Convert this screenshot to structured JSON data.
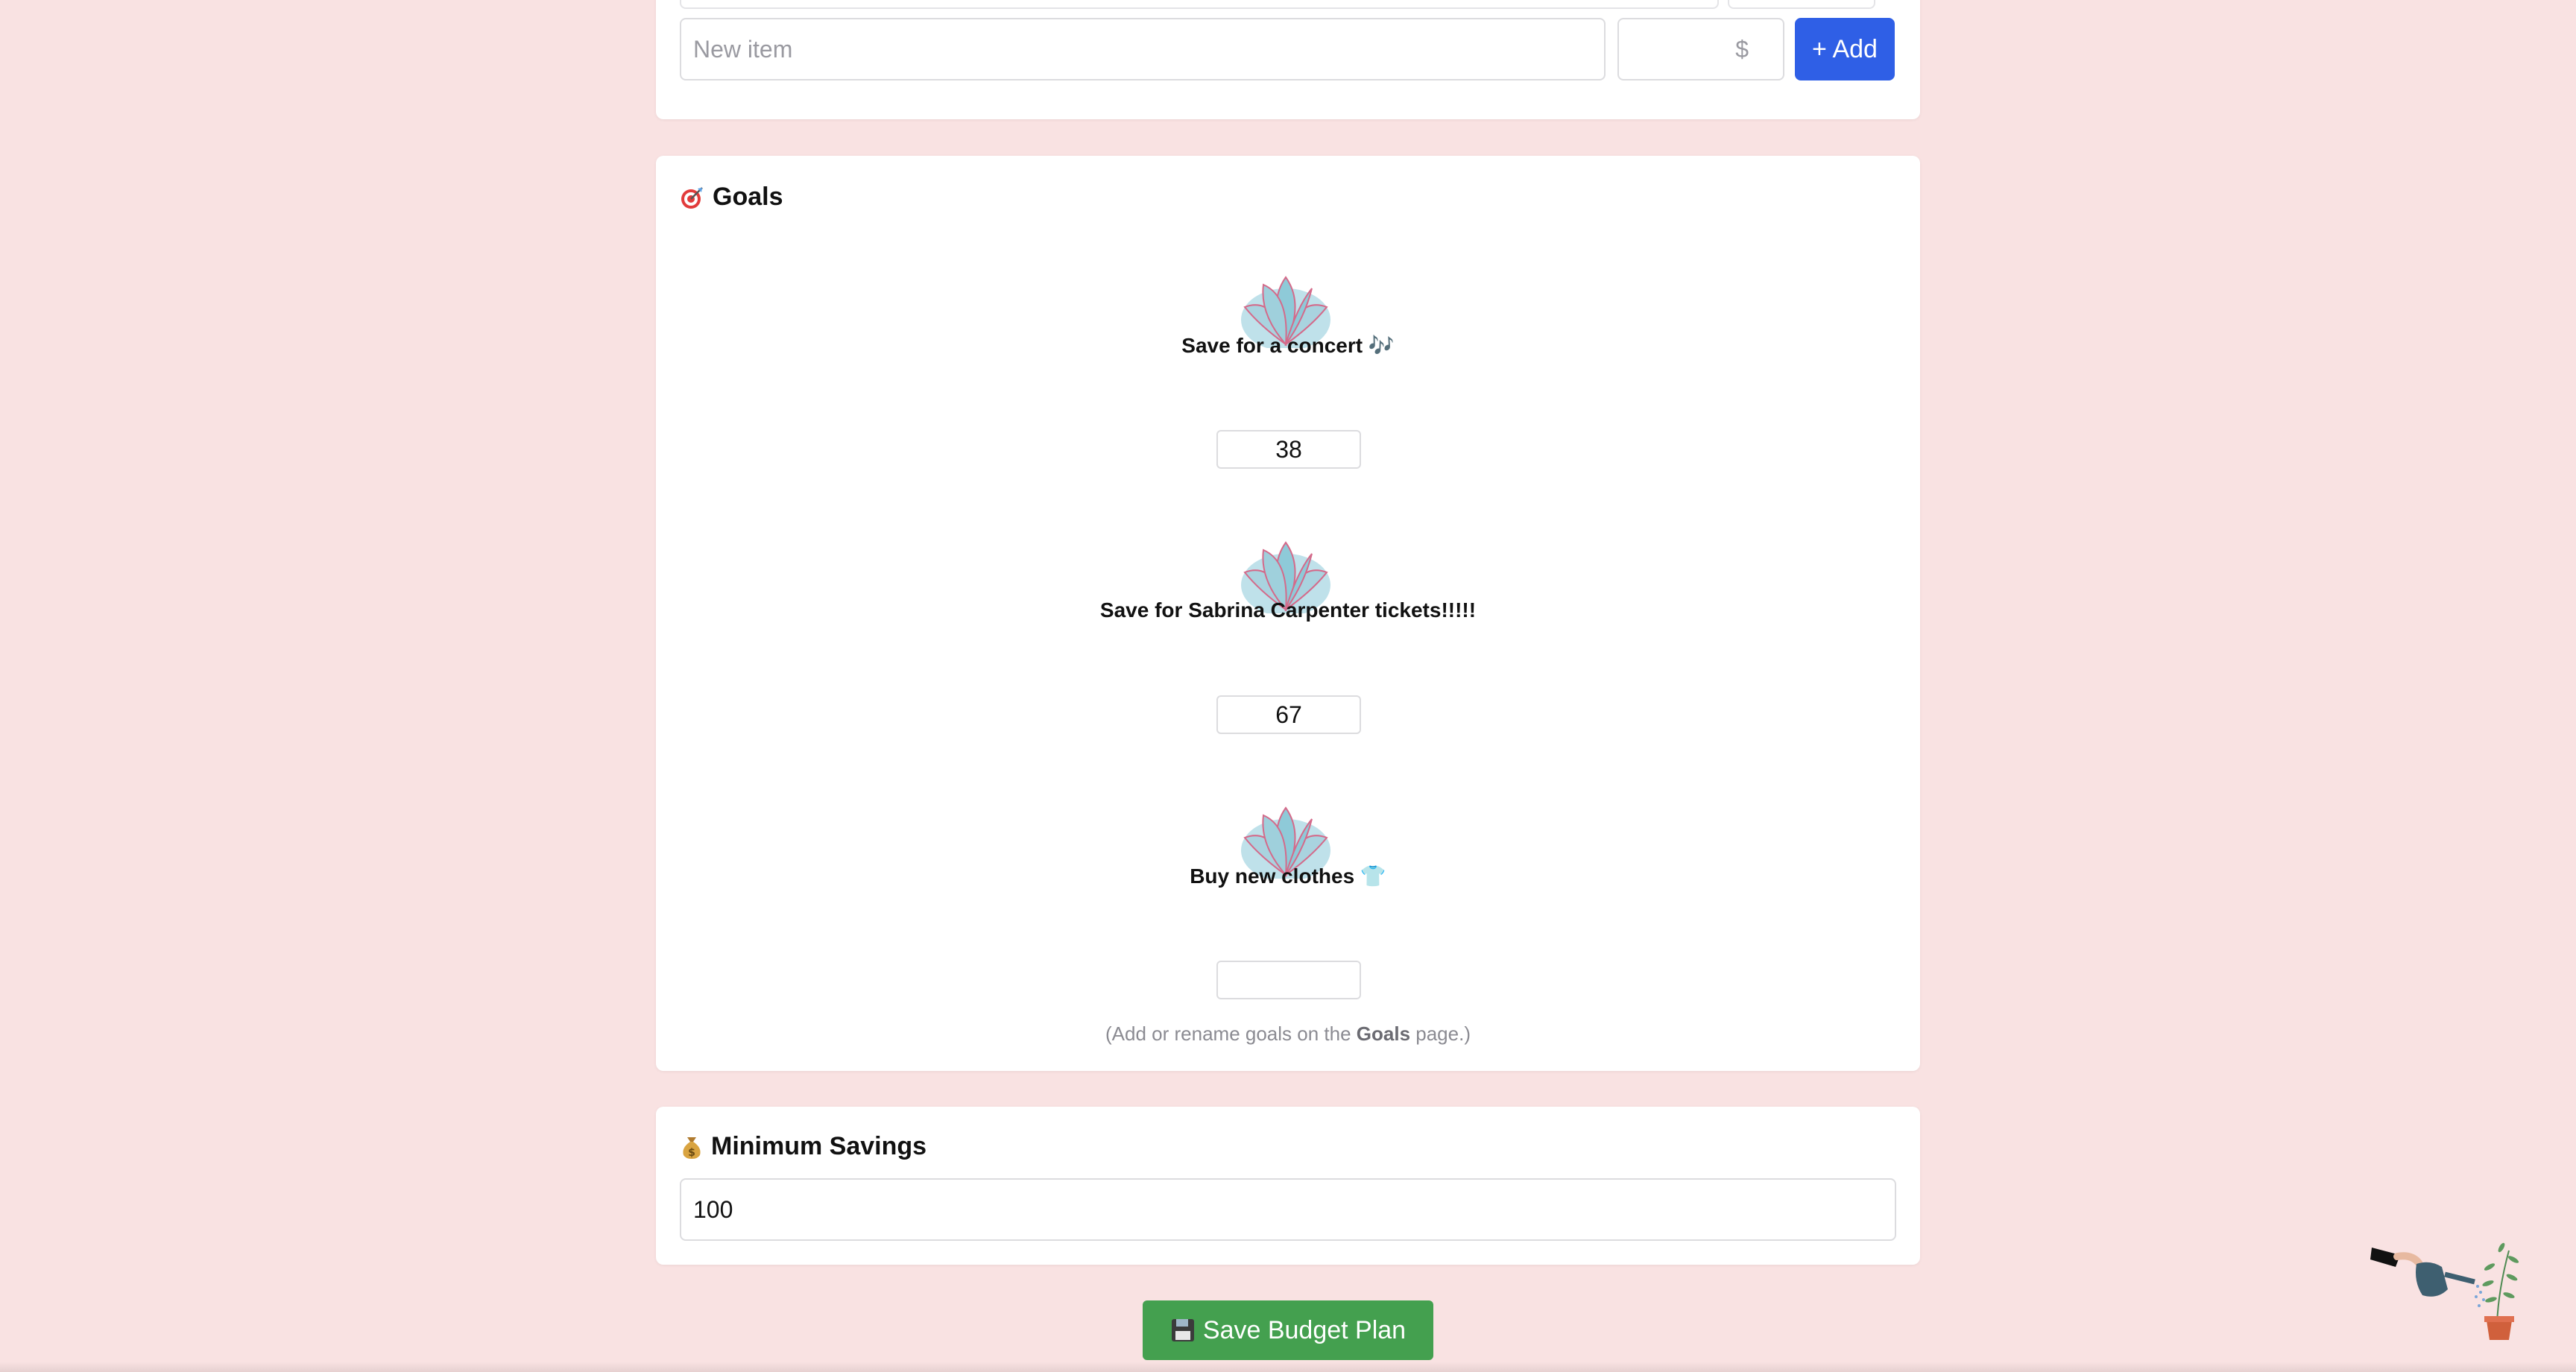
{
  "add_item": {
    "name_placeholder": "New item",
    "amount_placeholder": "$",
    "add_label": "+ Add"
  },
  "goals": {
    "title": "Goals",
    "title_icon": "target-icon",
    "items": [
      {
        "label": "Save for a concert 🎶",
        "value": "38"
      },
      {
        "label": "Save for Sabrina Carpenter tickets!!!!!",
        "value": "67"
      },
      {
        "label": "Buy new clothes 👕",
        "value": ""
      }
    ],
    "hint_prefix": "(Add or rename goals on the ",
    "hint_link": "Goals",
    "hint_suffix": " page.)"
  },
  "min_savings": {
    "title": "Minimum Savings",
    "title_icon": "money-bag-icon",
    "value": "100"
  },
  "save_button": {
    "label": "Save Budget Plan",
    "icon": "floppy-disk-icon"
  },
  "colors": {
    "background": "#f9e2e2",
    "add_button": "#2f5fe6",
    "save_button": "#44a04f"
  }
}
